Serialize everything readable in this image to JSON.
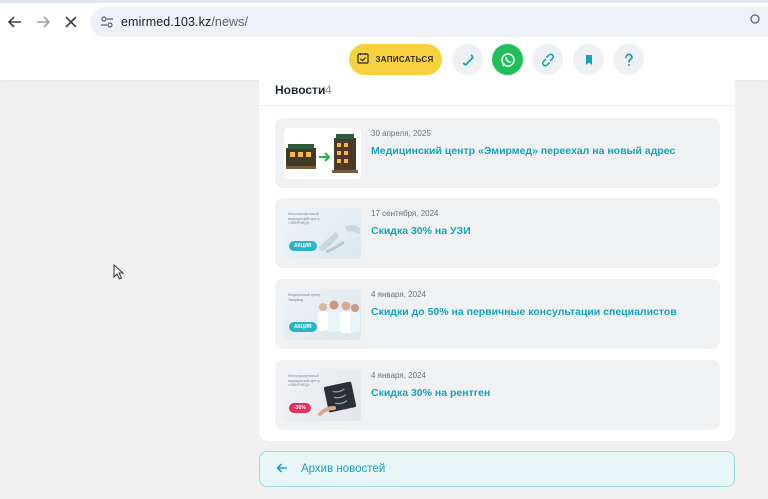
{
  "browser": {
    "url_host": "emirmed.103.kz",
    "url_path": "/news/",
    "icons": [
      "back-arrow-icon",
      "forward-arrow-icon",
      "stop-loading-icon",
      "site-info-icon"
    ]
  },
  "header": {
    "book_label": "ЗАПИСАТЬСЯ",
    "accent_color": "#f7d23e",
    "icons": [
      "calendar-check-icon",
      "phone-icon",
      "whatsapp-icon",
      "link-icon",
      "bookmark-icon",
      "help-icon"
    ]
  },
  "news": {
    "title": "Новости",
    "count": "4",
    "items": [
      {
        "date": "30 апреля, 2025",
        "title": "Медицинский центр «Эмирмед» переехал на новый адрес",
        "thumb": "relocation-image"
      },
      {
        "date": "17 сентября, 2024",
        "title": "Скидка 30% на УЗИ",
        "thumb": "ultrasound-promo-image",
        "badge": "АКЦИЯ",
        "caption": "Многопрофильный медицинский центр «ЭМИРМЕД»"
      },
      {
        "date": "4 января, 2024",
        "title": "Скидки до 50% на первичные консультации специалистов",
        "thumb": "doctors-promo-image",
        "badge": "АКЦИЯ",
        "caption": "Медицинский центр Эмирмед"
      },
      {
        "date": "4 января, 2024",
        "title": "Скидка 30% на рентген",
        "thumb": "xray-promo-image",
        "badge": "-30%",
        "caption": "Многопрофильный медицинский центр «ЭМИРМЕД»"
      }
    ],
    "link_color": "#17a3b8"
  },
  "archive": {
    "label": "Архив новостей"
  }
}
